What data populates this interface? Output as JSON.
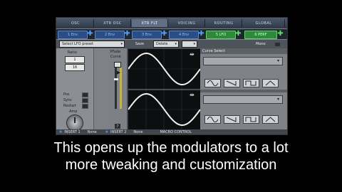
{
  "tabs": [
    "OSC",
    "XTR OSC",
    "XTR FLT",
    "VOICING",
    "ROUTING",
    "GLOBAL"
  ],
  "active_tab": "XTR FLT",
  "modulators": [
    {
      "label": "1 Env",
      "color": "blue"
    },
    {
      "label": "2 Env",
      "color": "blue"
    },
    {
      "label": "3 Env",
      "color": "blue"
    },
    {
      "label": "4 Env",
      "color": "blue"
    },
    {
      "label": "5 LFO",
      "color": "green"
    },
    {
      "label": "6 PERF",
      "color": "green"
    }
  ],
  "controls": {
    "preset_select": "Select LFO preset",
    "save": "Save",
    "delete": "Delete",
    "mono": "Mono"
  },
  "left_panel": {
    "ratio_label": "Ratio",
    "ratio_value_1": "1",
    "ratio_value_2": "16",
    "pos_label": "Pos",
    "sync_label": "Sync",
    "restart_label": "Restart",
    "amp_label": "Amp"
  },
  "fade_panel": {
    "label_1": "XFade",
    "label_2": "Curve",
    "help": "?"
  },
  "curve_select_label": "Curve Select",
  "bottom_bar": {
    "insert1_label": "INSERT 1",
    "insert1_value": "None",
    "insert2_label": "INSERT 2",
    "insert2_value": "None",
    "macro": "MACRO CONTROL"
  },
  "caption": {
    "line1": "This opens up the modulators to a lot",
    "line2": "more tweaking and customization"
  }
}
